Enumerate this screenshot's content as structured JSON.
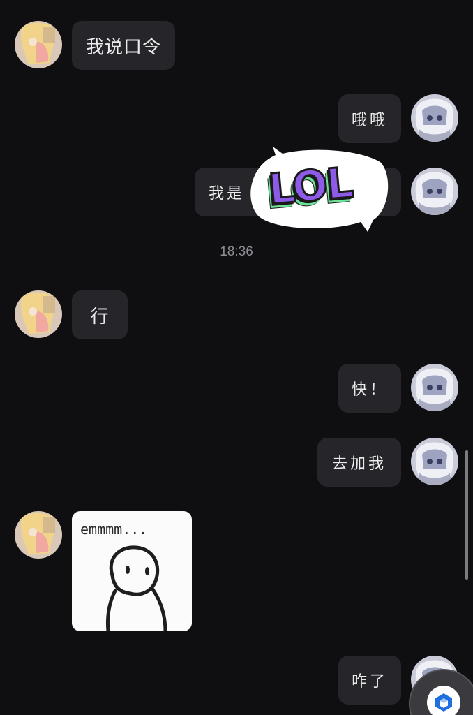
{
  "messages": [
    {
      "side": "left",
      "text": "我说口令"
    },
    {
      "side": "right",
      "text": "哦哦"
    },
    {
      "side": "right",
      "text": "我是"
    },
    {
      "side": "left",
      "text": "行"
    },
    {
      "side": "right",
      "text": "快！"
    },
    {
      "side": "right",
      "text": "去加我"
    },
    {
      "side": "left",
      "sticker_caption": "emmmm..."
    },
    {
      "side": "right",
      "text": "咋了"
    }
  ],
  "timestamp": "18:36",
  "lol_sticker": {
    "text": "LOL"
  },
  "colors": {
    "background": "#0f0f12",
    "bubble": "#26262a",
    "timestamp": "#8d8d93",
    "lol_purple": "#8d5be8",
    "lol_green": "#6de39a",
    "fab_icon": "#1e6fe0"
  },
  "icons": {
    "floating_action": "cube-icon"
  }
}
